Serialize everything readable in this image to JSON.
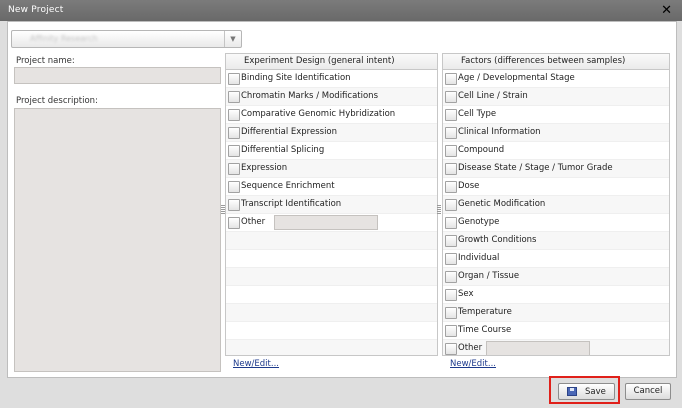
{
  "dialog": {
    "title": "New Project"
  },
  "project_select": {
    "value": "Affinity Research"
  },
  "project_name": {
    "label": "Project name:",
    "value": ""
  },
  "project_description": {
    "label": "Project description:",
    "value": ""
  },
  "experiment_design": {
    "header": "Experiment Design (general intent)",
    "items": [
      "Binding Site Identification",
      "Chromatin Marks / Modifications",
      "Comparative Genomic Hybridization",
      "Differential Expression",
      "Differential Splicing",
      "Expression",
      "Sequence Enrichment",
      "Transcript Identification"
    ],
    "other_label": "Other",
    "other_value": "",
    "new_edit_link": "New/Edit..."
  },
  "factors": {
    "header": "Factors (differences between samples)",
    "items": [
      "Age / Developmental Stage",
      "Cell Line / Strain",
      "Cell Type",
      "Clinical Information",
      "Compound",
      "Disease State / Stage / Tumor Grade",
      "Dose",
      "Genetic Modification",
      "Genotype",
      "Growth Conditions",
      "Individual",
      "Organ / Tissue",
      "Sex",
      "Temperature",
      "Time Course"
    ],
    "other_label": "Other",
    "other_value": "",
    "new_edit_link": "New/Edit..."
  },
  "footer": {
    "save_label": "Save",
    "cancel_label": "Cancel"
  },
  "colors": {
    "highlight": "#e0201a",
    "titlebar": "#6f6f6f",
    "link": "#1d3a8c"
  },
  "icons": {
    "close": "close-icon",
    "dropdown": "chevron-down-icon",
    "save": "save-disk-icon"
  }
}
